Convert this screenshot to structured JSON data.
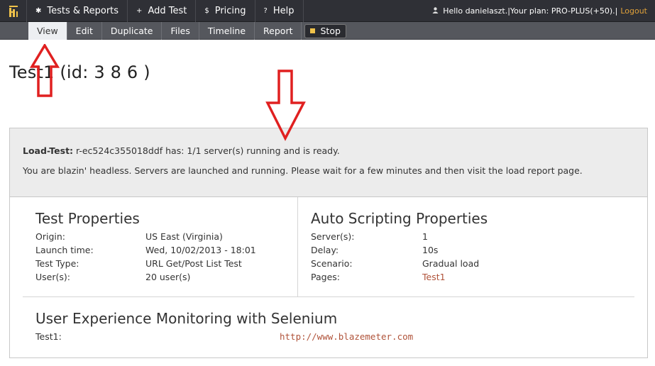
{
  "topnav": {
    "logo_icon": "blazemeter-logo-icon",
    "items": [
      {
        "icon": "✱",
        "label": "Tests & Reports"
      },
      {
        "icon": "+",
        "label": "Add Test"
      },
      {
        "icon": "$",
        "label": "Pricing"
      },
      {
        "icon": "?",
        "label": "Help"
      }
    ],
    "user": {
      "icon": "user-icon",
      "greeting": "Hello danielaszt.",
      "plan": "|Your plan: PRO-PLUS(+50).|",
      "logout": "Logout"
    }
  },
  "subnav": {
    "items": [
      "View",
      "Edit",
      "Duplicate",
      "Files",
      "Timeline",
      "Report"
    ],
    "active": "View",
    "stop_label": "Stop"
  },
  "page_title": "Test1 (id: 3  8  6  )",
  "status": {
    "bold_label": "Load-Test:",
    "line1": " r-ec524c355018ddf has: 1/1 server(s) running and is ready.",
    "line2": "You are blazin' headless. Servers are launched and running. Please wait for a few minutes and then visit the load report page."
  },
  "test_properties": {
    "title": "Test Properties",
    "rows": [
      {
        "key": "Origin:",
        "value": "US East (Virginia)"
      },
      {
        "key": "Launch time:",
        "value": "Wed, 10/02/2013 - 18:01"
      },
      {
        "key": "Test Type:",
        "value": "URL Get/Post List Test"
      },
      {
        "key": "User(s):",
        "value": "20 user(s)"
      }
    ]
  },
  "auto_scripting": {
    "title": "Auto Scripting Properties",
    "rows": [
      {
        "key": "Server(s):",
        "value": "1"
      },
      {
        "key": "Delay:",
        "value": "10s"
      },
      {
        "key": "Scenario:",
        "value": "Gradual load"
      },
      {
        "key": "Pages:",
        "value": "Test1"
      }
    ]
  },
  "uem": {
    "title": "User Experience Monitoring with Selenium",
    "label": "Test1:",
    "url": "http://www.blazemeter.com"
  },
  "colors": {
    "topbar": "#2f3036",
    "subbar": "#55575d",
    "link": "#b0533a",
    "logout": "#e0a13a",
    "stop_square": "#f0c24a",
    "annotation": "#e02020"
  }
}
